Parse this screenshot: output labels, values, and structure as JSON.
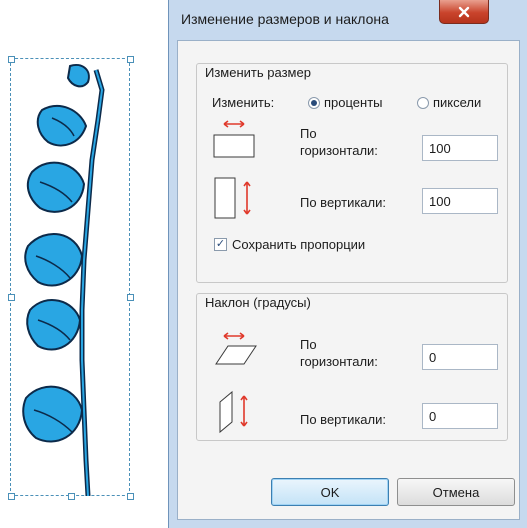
{
  "dialog": {
    "title": "Изменение размеров и наклона",
    "close_icon": "close-x-icon"
  },
  "resize": {
    "group_label": "Изменить размер",
    "by_label": "Изменить:",
    "percent_label": "проценты",
    "pixels_label": "пиксели",
    "selected_unit": "проценты",
    "horizontal_label_1": "По",
    "horizontal_label_2": "горизонтали:",
    "horizontal_value": "100",
    "vertical_label": "По вертикали:",
    "vertical_value": "100",
    "keep_ratio_label": "Сохранить пропорции",
    "keep_ratio_checked": true
  },
  "skew": {
    "group_label": "Наклон (градусы)",
    "horizontal_label_1": "По",
    "horizontal_label_2": "горизонтали:",
    "horizontal_value": "0",
    "vertical_label": "По вертикали:",
    "vertical_value": "0"
  },
  "buttons": {
    "ok_label": "OK",
    "cancel_label": "Отмена"
  },
  "colors": {
    "accent_arrow": "#e0392b",
    "flower_fill": "#29a6e3",
    "flower_outline": "#0c2a4a",
    "dialog_frame": "#c6d9ee"
  }
}
